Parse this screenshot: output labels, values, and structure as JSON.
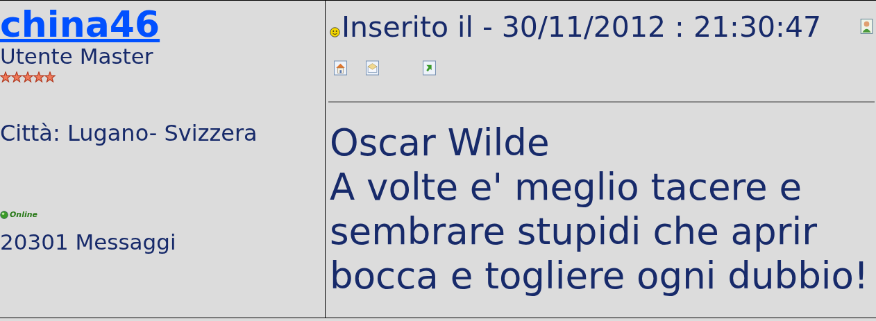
{
  "author": {
    "username": "china46",
    "rank": "Utente Master",
    "stars": 5,
    "city": "Città: Lugano- Svizzera",
    "online": true,
    "online_label": "Online",
    "posts": "20301 Messaggi"
  },
  "post": {
    "posted": "Inserito il - 30/11/2012 : 21:30:47",
    "body": "Oscar Wilde\nA volte e' meglio tacere e\nsembrare stupidi che aprir\nbocca e togliere ogni dubbio!"
  }
}
